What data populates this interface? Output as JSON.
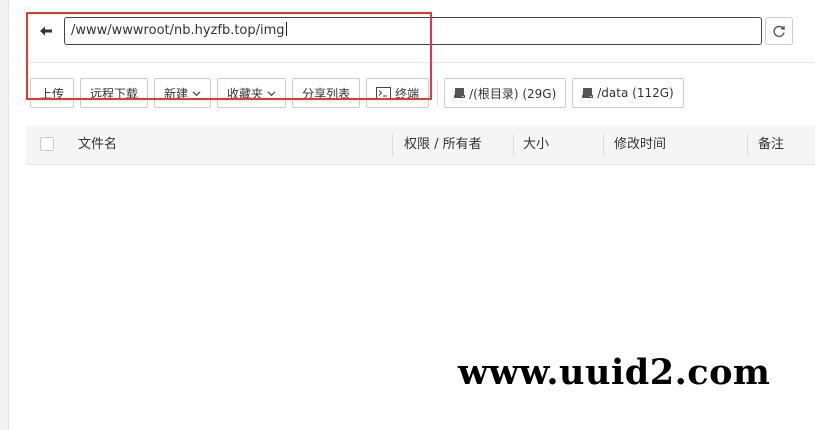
{
  "path_bar": {
    "value": "/www/wwwroot/nb.hyzfb.top/img"
  },
  "toolbar": {
    "upload": "上传",
    "remote_download": "远程下载",
    "new": "新建",
    "favorites": "收藏夹",
    "share_list": "分享列表",
    "terminal": "终端",
    "disks": [
      {
        "label": "/(根目录) (29G)"
      },
      {
        "label": "/data (112G)"
      }
    ]
  },
  "table": {
    "columns": [
      "文件名",
      "权限 / 所有者",
      "大小",
      "修改时间",
      "备注"
    ]
  },
  "watermark": "www.uuid2.com",
  "colors": {
    "highlight": "#e53935"
  },
  "icons": {
    "back": "back-arrow-icon",
    "refresh": "refresh-icon",
    "chevron": "chevron-down-icon",
    "terminal": "terminal-icon",
    "disk": "disk-icon"
  }
}
